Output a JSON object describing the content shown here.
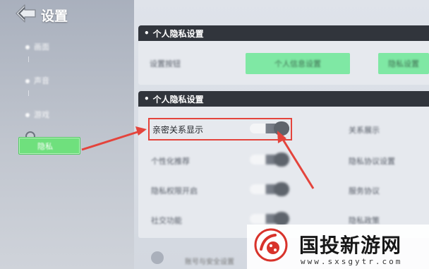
{
  "header": {
    "title": "设置",
    "back_icon": "back-arrow-icon"
  },
  "sidebar": {
    "items": [
      {
        "label": "画面"
      },
      {
        "label": "声音"
      },
      {
        "label": "游戏"
      },
      {
        "label": "隐私"
      }
    ],
    "active_index": 3
  },
  "sections": [
    {
      "title": "个人隐私设置",
      "rows": [
        {
          "label": "设置按钮",
          "buttons": [
            "个人信息设置",
            "隐私设置"
          ]
        }
      ]
    },
    {
      "title": "个人隐私设置",
      "rows": [
        {
          "label": "亲密关系显示",
          "toggle_on": false,
          "highlighted": true,
          "right_label": "关系展示"
        },
        {
          "label": "个性化推荐",
          "toggle_on": false,
          "right_label": "隐私协议设置"
        },
        {
          "label": "隐私权限开启",
          "toggle_on": false,
          "right_label": "服务协议"
        },
        {
          "label": "社交功能",
          "toggle_on": false,
          "right_label": "隐私政策"
        }
      ]
    }
  ],
  "footer": {
    "text": "账号与安全设置"
  },
  "watermark": {
    "brand": "国投新游网",
    "url": "www.sxsgytr.com"
  },
  "colors": {
    "highlight": "#e4443c",
    "accent_green": "#6fe07d",
    "section_header": "#31353c"
  }
}
